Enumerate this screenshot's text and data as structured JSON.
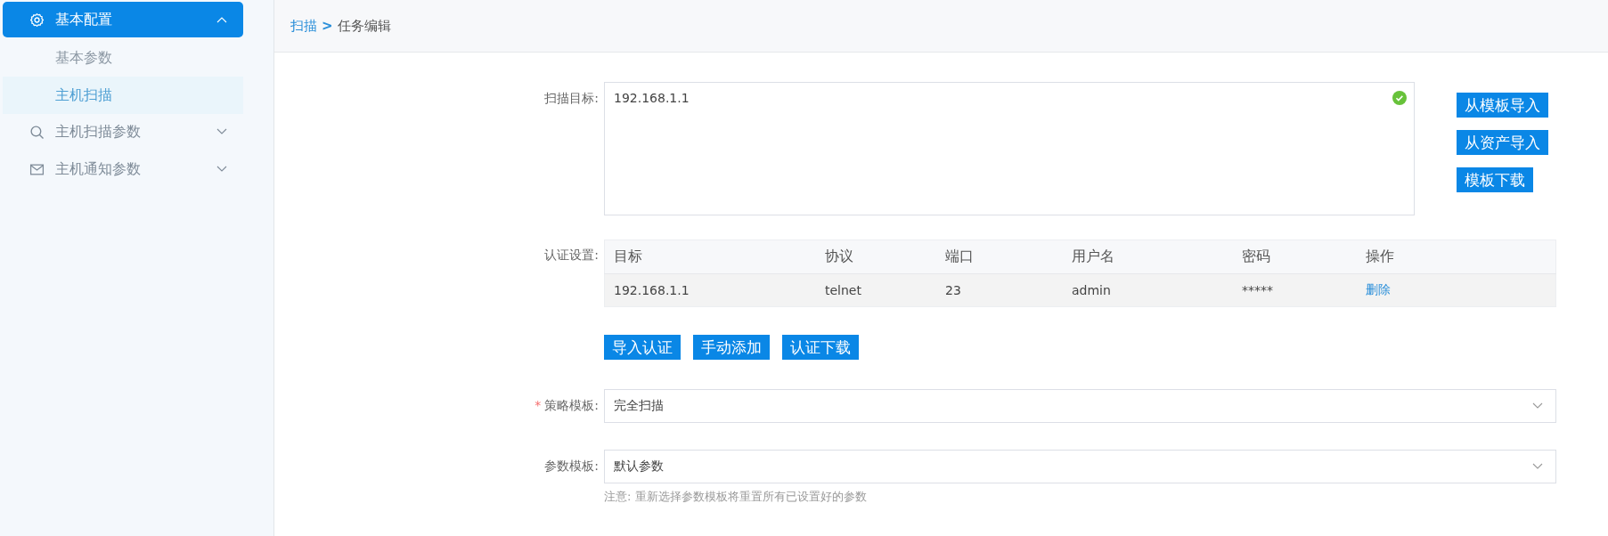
{
  "sidebar": {
    "items": [
      {
        "label": "基本配置",
        "kind": "gear",
        "selected": true,
        "expanded": true,
        "children": [
          {
            "label": "基本参数",
            "selected": false
          },
          {
            "label": "主机扫描",
            "selected": true
          }
        ]
      },
      {
        "label": "主机扫描参数",
        "kind": "search",
        "selected": false,
        "expanded": false
      },
      {
        "label": "主机通知参数",
        "kind": "mail",
        "selected": false,
        "expanded": false
      }
    ]
  },
  "breadcrumb": {
    "link": "扫描",
    "separator": ">",
    "current": "任务编辑"
  },
  "scan_target": {
    "label": "扫描目标:",
    "value": "192.168.1.1",
    "valid": true,
    "buttons": [
      "从模板导入",
      "从资产导入",
      "模板下载"
    ]
  },
  "auth": {
    "label": "认证设置:",
    "columns": [
      "目标",
      "协议",
      "端口",
      "用户名",
      "密码",
      "操作"
    ],
    "rows": [
      {
        "cells": [
          "192.168.1.1",
          "telnet",
          "23",
          "admin",
          "*****"
        ],
        "action": "删除"
      }
    ],
    "buttons": [
      "导入认证",
      "手动添加",
      "认证下载"
    ]
  },
  "policy": {
    "label": "策略模板:",
    "required_mark": "*",
    "value": "完全扫描"
  },
  "params": {
    "label": "参数模板:",
    "value": "默认参数",
    "note": "注意: 重新选择参数模板将重置所有已设置好的参数"
  }
}
